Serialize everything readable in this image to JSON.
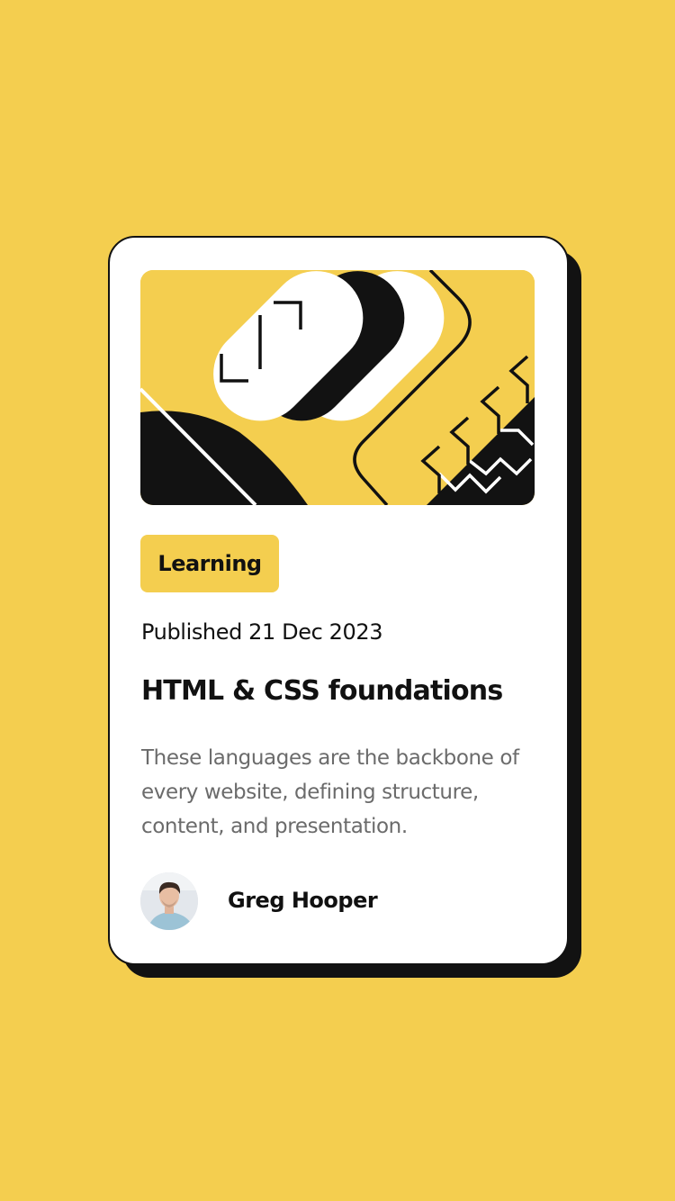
{
  "colors": {
    "background": "#f4ce4f",
    "card": "#ffffff",
    "ink": "#121212",
    "muted_text": "#6b6b6b"
  },
  "card": {
    "image": {
      "icon": "abstract-illustration-icon"
    },
    "tag": "Learning",
    "published": "Published 21 Dec 2023",
    "title": "HTML & CSS foundations",
    "description": "These languages are the backbone of every website, defining structure, content, and presentation.",
    "author": {
      "name": "Greg Hooper",
      "avatar_icon": "avatar-photo-icon"
    }
  }
}
